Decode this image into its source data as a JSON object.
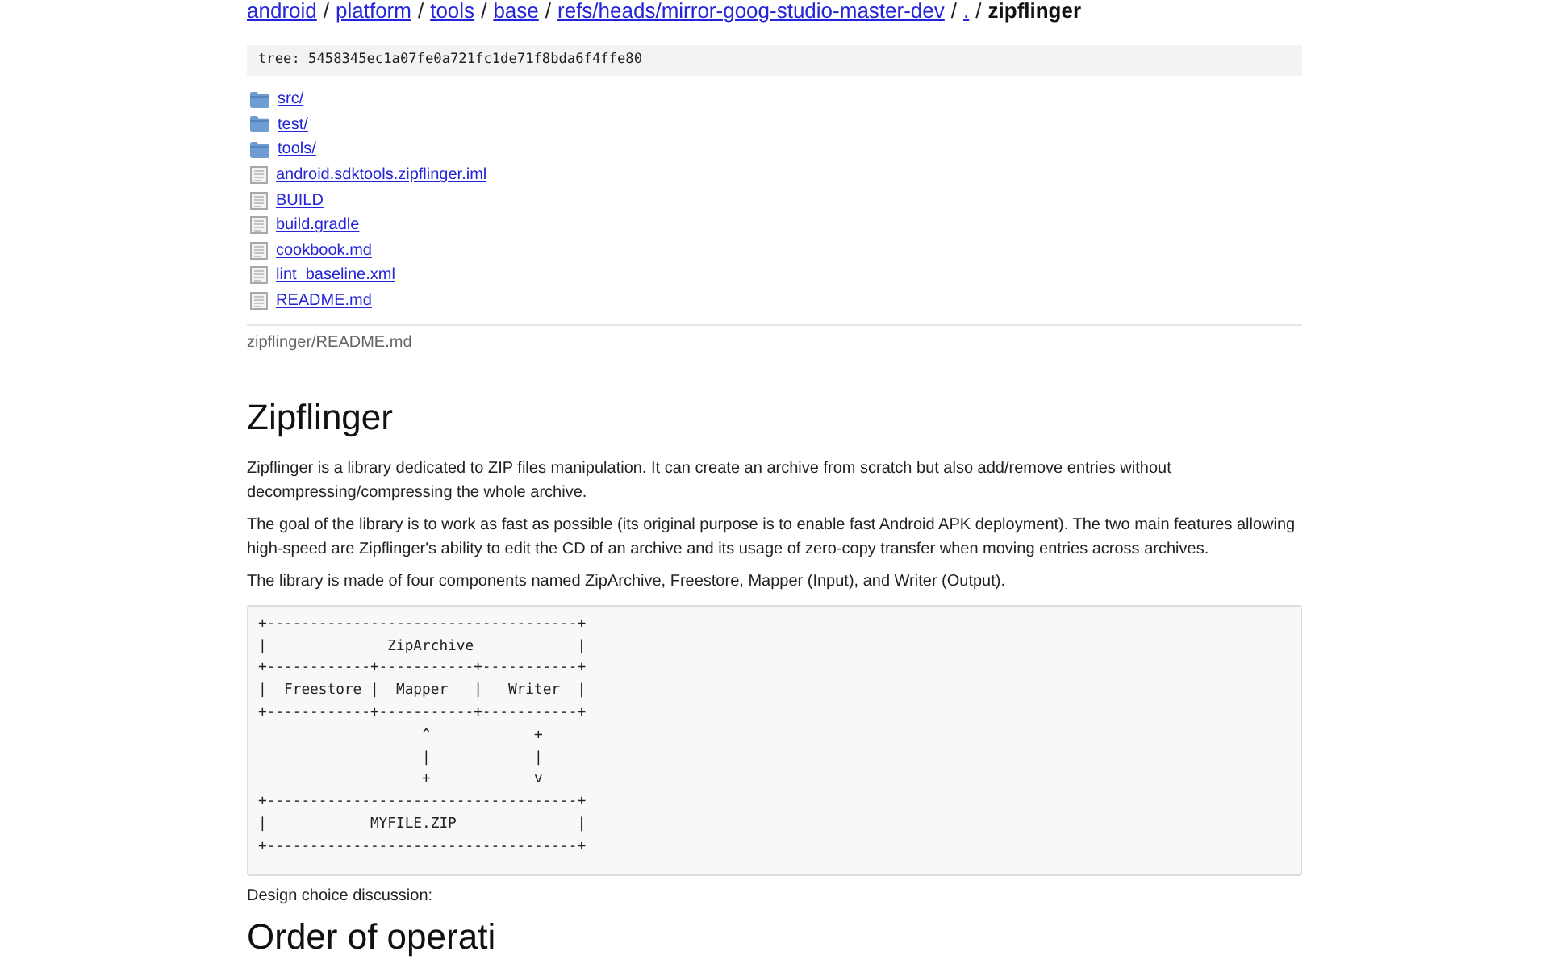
{
  "breadcrumb": [
    {
      "kind": "link",
      "label": "android",
      "separator": "/"
    },
    {
      "kind": "link",
      "label": "platform",
      "separator": "/"
    },
    {
      "kind": "link",
      "label": "tools",
      "separator": "/"
    },
    {
      "kind": "link",
      "label": "base",
      "separator": "/"
    },
    {
      "kind": "link",
      "label": "refs/heads/mirror-goog-studio-master-dev",
      "separator": "/"
    },
    {
      "kind": "link",
      "label": ".",
      "separator": "/"
    },
    {
      "kind": "current",
      "label": "zipflinger"
    }
  ],
  "tree": "tree: 5458345ec1a07fe0a721fc1de71f8bda6f4ffe80",
  "entries": [
    {
      "kind": "folder",
      "name": "src/"
    },
    {
      "kind": "folder",
      "name": "test/"
    },
    {
      "kind": "folder",
      "name": "tools/"
    },
    {
      "kind": "file",
      "name": "android.sdktools.zipflinger.iml"
    },
    {
      "kind": "file",
      "name": "BUILD"
    },
    {
      "kind": "file",
      "name": "build.gradle"
    },
    {
      "kind": "file",
      "name": "cookbook.md"
    },
    {
      "kind": "file",
      "name": "lint_baseline.xml"
    },
    {
      "kind": "file",
      "name": "README.md"
    }
  ],
  "readme": {
    "path": "zipflinger/README.md",
    "blocks": [
      {
        "kind": "heading",
        "text": "Zipflinger"
      },
      {
        "kind": "paragraph",
        "text": "Zipflinger is a library dedicated to ZIP files manipulation. It can create an archive from scratch but also add/remove entries without decompressing/compressing the whole archive."
      },
      {
        "kind": "paragraph",
        "text": "The goal of the library is to work as fast as possible (its original purpose is to enable fast Android APK deployment). The two main features allowing high-speed are Zipflinger's ability to edit the CD of an archive and its usage of zero-copy transfer when moving entries across archives."
      },
      {
        "kind": "paragraph",
        "text": "The library is made of four components named ZipArchive, Freestore, Mapper (Input), and Writer (Output)."
      },
      {
        "kind": "code",
        "text": "+------------------------------------+\n|              ZipArchive            |\n+------------+-----------+-----------+\n|  Freestore |  Mapper   |   Writer  |\n+------------+-----------+-----------+\n                   ^            +\n                   |            |\n                   +            v\n+------------------------------------+\n|            MYFILE.ZIP              |\n+------------------------------------+"
      },
      {
        "kind": "paragraph",
        "text": "Design choice discussion:"
      },
      {
        "kind": "heading",
        "text": "Order of operati"
      }
    ]
  }
}
